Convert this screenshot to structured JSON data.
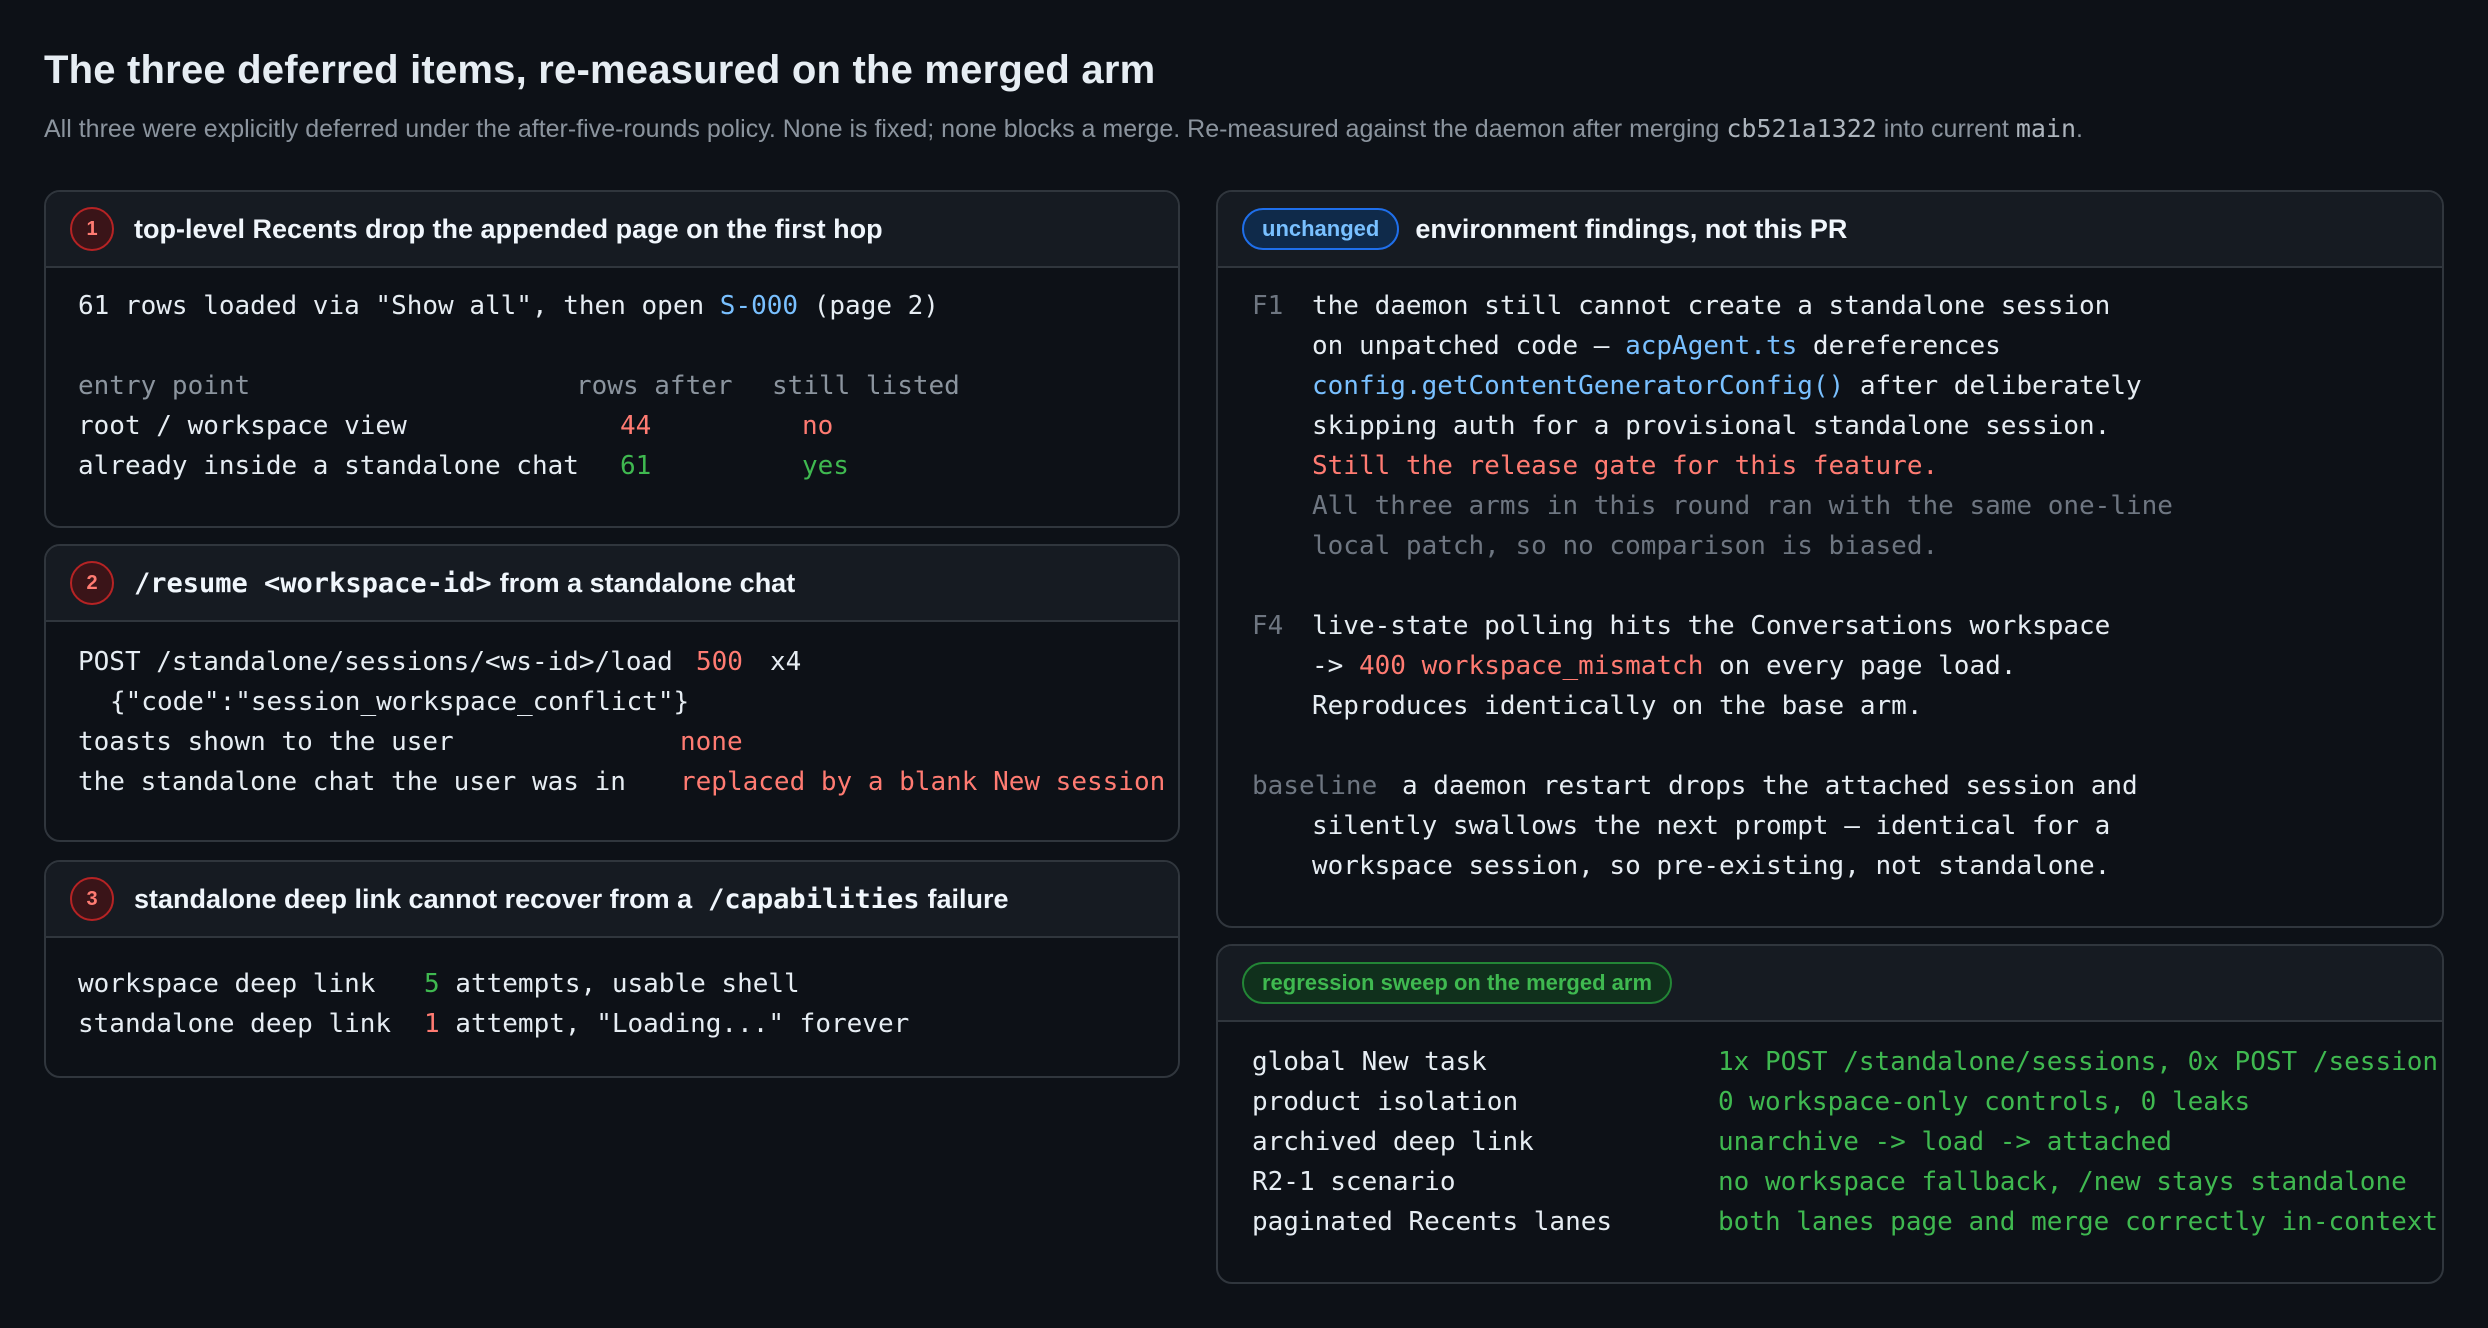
{
  "header": {
    "title": "The three deferred items, re-measured on the merged arm",
    "subtitle_pre": "All three were explicitly deferred under the after-five-rounds policy. None is fixed; none blocks a merge. Re-measured against the daemon after merging ",
    "subtitle_commit": "cb521a1322",
    "subtitle_mid": " into current ",
    "subtitle_branch": "main",
    "subtitle_end": "."
  },
  "item1": {
    "number": "1",
    "title": "top-level Recents drop the appended page on the first hop",
    "intro_pre": "61 rows loaded via \"Show all\", then open ",
    "intro_link": "S-000",
    "intro_post": " (page 2)",
    "columns": [
      "entry point",
      "rows after",
      "still listed"
    ],
    "rows": [
      {
        "entry": "root / workspace view",
        "rows_after": "44",
        "still_listed": "no"
      },
      {
        "entry": "already inside a standalone chat",
        "rows_after": "61",
        "still_listed": "yes"
      }
    ]
  },
  "item2": {
    "number": "2",
    "title_code": "/resume <workspace-id>",
    "title_text": "from a standalone chat",
    "line1_pre": "POST /standalone/sessions/<ws-id>/load",
    "line1_status": "500",
    "line1_count": "x4",
    "line2": "{\"code\":\"session_workspace_conflict\"}",
    "line3_label": "toasts shown to the user",
    "line3_value": "none",
    "line4_label": "the standalone chat the user was in",
    "line4_value": "replaced by a blank New session"
  },
  "item3": {
    "number": "3",
    "title_pre": "standalone deep link cannot recover from a",
    "title_code": "/capabilities",
    "title_post": "failure",
    "rows": [
      {
        "label": "workspace deep link",
        "count": "5",
        "text": " attempts, usable shell"
      },
      {
        "label": "standalone deep link",
        "count": "1",
        "text": " attempt, \"Loading...\" forever"
      }
    ]
  },
  "env": {
    "badge": "unchanged",
    "title": "environment findings, not this PR",
    "f1_tag": "F1",
    "f1_l1": "the daemon still cannot create a standalone session",
    "f1_l2_pre": "on unpatched code — ",
    "f1_l2_link": "acpAgent.ts",
    "f1_l2_post": " dereferences",
    "f1_l3_link": "config.getContentGeneratorConfig()",
    "f1_l3_post": " after deliberately",
    "f1_l4": "skipping auth for a provisional standalone session.",
    "f1_l5": "Still the release gate for this feature.",
    "f1_l6": "All three arms in this round ran with the same one-line",
    "f1_l7": "local patch, so no comparison is biased.",
    "f4_tag": "F4",
    "f4_l1": "live-state polling hits the Conversations workspace",
    "f4_l2_pre": "-> ",
    "f4_l2_err": "400 workspace_mismatch",
    "f4_l2_post": " on every page load.",
    "f4_l3": "Reproduces identically on the base arm.",
    "base_tag": "baseline",
    "base_l1": "a daemon restart drops the attached session and",
    "base_l2": "silently swallows the next prompt — identical for a",
    "base_l3": "workspace session, so pre-existing, not standalone."
  },
  "sweep": {
    "badge": "regression sweep on the merged arm",
    "rows": [
      {
        "label": "global New task",
        "value": "1x POST /standalone/sessions, 0x POST /session"
      },
      {
        "label": "product isolation",
        "value": "0 workspace-only controls, 0 leaks"
      },
      {
        "label": "archived deep link",
        "value": "unarchive -> load -> attached"
      },
      {
        "label": "R2-1 scenario",
        "value": "no workspace fallback, /new stays standalone"
      },
      {
        "label": "paginated Recents lanes",
        "value": "both lanes page and merge correctly in-context"
      }
    ]
  },
  "colors": {
    "background": "#0d1117",
    "panel": "#161b22",
    "border": "#30363d",
    "red": "#ff7b72",
    "green": "#3fb950",
    "blue": "#79c0ff"
  }
}
